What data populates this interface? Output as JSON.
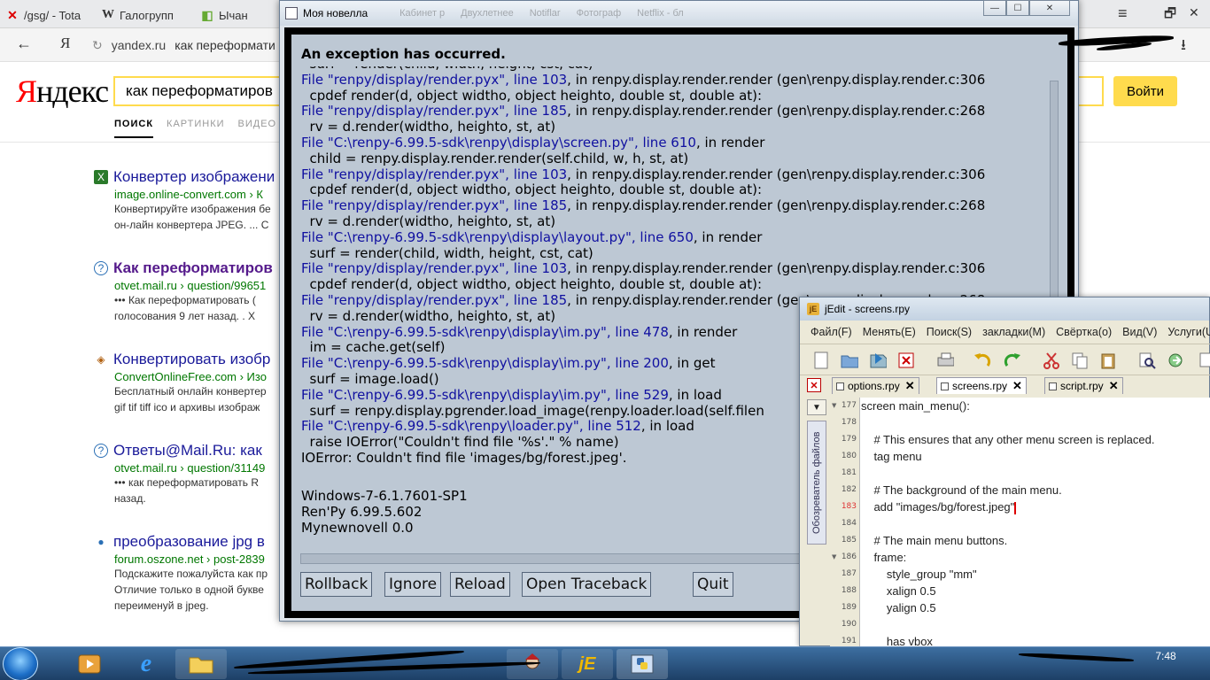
{
  "browser": {
    "tabs": [
      {
        "icon": "✕",
        "label": "/gsg/ - Tota"
      },
      {
        "icon": "W",
        "label": "Галогрупп"
      },
      {
        "icon": "◧",
        "label": "Ычан"
      }
    ],
    "back": "←",
    "yandex_letter": "Я",
    "reload": "↻",
    "address_domain": "yandex.ru",
    "address_query": "как переформати",
    "menu": "≡",
    "restore": "🗗",
    "close": "✕",
    "download": "⭳"
  },
  "yandex": {
    "logo_red": "Я",
    "logo_black": "ндекс",
    "search_value": "как переформатиров",
    "search_button": "Войти",
    "nav": [
      "ПОИСК",
      "КАРТИНКИ",
      "ВИДЕО"
    ],
    "results": [
      {
        "icon": "X",
        "title": "Конвертер изображени",
        "url": "image.online-convert.com › К",
        "snippet": [
          "Конвертируйте изображения бе",
          "он-лайн конвертера JPEG. ... C"
        ]
      },
      {
        "icon": "?",
        "title": "Как переформатиров",
        "url": "otvet.mail.ru › question/99651",
        "snippet": [
          "••• Как переформатировать (",
          "голосования 9 лет назад. . Х"
        ]
      },
      {
        "icon": "◈",
        "title": "Конвертировать изобр",
        "url": "ConvertOnlineFree.com › Изо",
        "snippet": [
          "Бесплатный онлайн конвертер",
          "gif tif tiff ico и архивы изображ"
        ]
      },
      {
        "icon": "?",
        "title": "Ответы@Mail.Ru: как",
        "url": "otvet.mail.ru › question/31149",
        "snippet": [
          "••• как переформатировать R",
          "назад."
        ]
      },
      {
        "icon": "●",
        "title": "преобразование jpg в",
        "url": "forum.oszone.net › post-2839",
        "snippet": [
          "Подскажите пожалуйста как пр",
          "Отличие только в одной букве",
          "переименуй в jpeg."
        ]
      }
    ]
  },
  "renpy": {
    "window_title": "Моя новелла",
    "ghost_tabs": [
      "Кабинет р",
      "Двухлетнее",
      "Notiflar",
      "Фотограф",
      "Netflix - бл"
    ],
    "controls": {
      "minimize": "—",
      "maximize": "☐",
      "close": "✕"
    },
    "exception_title": "An exception has occurred.",
    "traceback": [
      {
        "type": "cut",
        "text": "  surf = render(child, width, height, cst, cat)"
      },
      {
        "type": "file",
        "file": "File \"renpy/display/render.pyx\", line 103",
        "rest": ", in renpy.display.render.render (gen\\renpy.display.render.c:306"
      },
      {
        "type": "src",
        "text": "  cpdef render(d, object widtho, object heighto, double st, double at):"
      },
      {
        "type": "file",
        "file": "File \"renpy/display/render.pyx\", line 185",
        "rest": ", in renpy.display.render.render (gen\\renpy.display.render.c:268"
      },
      {
        "type": "src",
        "text": "  rv = d.render(widtho, heighto, st, at)"
      },
      {
        "type": "file",
        "file": "File \"C:\\renpy-6.99.5-sdk\\renpy\\display\\screen.py\", line 610",
        "rest": ", in render"
      },
      {
        "type": "src",
        "text": "  child = renpy.display.render.render(self.child, w, h, st, at)"
      },
      {
        "type": "file",
        "file": "File \"renpy/display/render.pyx\", line 103",
        "rest": ", in renpy.display.render.render (gen\\renpy.display.render.c:306"
      },
      {
        "type": "src",
        "text": "  cpdef render(d, object widtho, object heighto, double st, double at):"
      },
      {
        "type": "file",
        "file": "File \"renpy/display/render.pyx\", line 185",
        "rest": ", in renpy.display.render.render (gen\\renpy.display.render.c:268"
      },
      {
        "type": "src",
        "text": "  rv = d.render(widtho, heighto, st, at)"
      },
      {
        "type": "file",
        "file": "File \"C:\\renpy-6.99.5-sdk\\renpy\\display\\layout.py\", line 650",
        "rest": ", in render"
      },
      {
        "type": "src",
        "text": "  surf = render(child, width, height, cst, cat)"
      },
      {
        "type": "file",
        "file": "File \"renpy/display/render.pyx\", line 103",
        "rest": ", in renpy.display.render.render (gen\\renpy.display.render.c:306"
      },
      {
        "type": "src",
        "text": "  cpdef render(d, object widtho, object heighto, double st, double at):"
      },
      {
        "type": "file",
        "file": "File \"renpy/display/render.pyx\", line 185",
        "rest": ", in renpy.display.render.render (gen\\renpy.display.render.c:268"
      },
      {
        "type": "src",
        "text": "  rv = d.render(widtho, heighto, st, at)"
      },
      {
        "type": "file",
        "file": "File \"C:\\renpy-6.99.5-sdk\\renpy\\display\\im.py\", line 478",
        "rest": ", in render"
      },
      {
        "type": "src",
        "text": "  im = cache.get(self)"
      },
      {
        "type": "file",
        "file": "File \"C:\\renpy-6.99.5-sdk\\renpy\\display\\im.py\", line 200",
        "rest": ", in get"
      },
      {
        "type": "src",
        "text": "  surf = image.load()"
      },
      {
        "type": "file",
        "file": "File \"C:\\renpy-6.99.5-sdk\\renpy\\display\\im.py\", line 529",
        "rest": ", in load"
      },
      {
        "type": "src",
        "text": "  surf = renpy.display.pgrender.load_image(renpy.loader.load(self.filen"
      },
      {
        "type": "file",
        "file": "File \"C:\\renpy-6.99.5-sdk\\renpy\\loader.py\", line 512",
        "rest": ", in load"
      },
      {
        "type": "src",
        "text": "  raise IOError(\"Couldn't find file '%s'.\" % name)"
      },
      {
        "type": "plain",
        "text": "IOError: Couldn't find file 'images/bg/forest.jpeg'."
      }
    ],
    "info": [
      "Windows-7-6.1.7601-SP1",
      "Ren'Py 6.99.5.602",
      "Mynewnovell 0.0"
    ],
    "buttons": {
      "rollback": "Rollback",
      "ignore": "Ignore",
      "reload": "Reload",
      "open_traceback": "Open Traceback",
      "quit": "Quit"
    }
  },
  "jedit": {
    "title": "jEdit - screens.rpy",
    "icon": "jE",
    "menu": [
      "Файл(F)",
      "Менять(E)",
      "Поиск(S)",
      "закладки(M)",
      "Свёртка(o)",
      "Вид(V)",
      "Услуги(U)"
    ],
    "tabs": [
      "options.rpy",
      "screens.rpy",
      "script.rpy"
    ],
    "side_panel": "Обозреватель файлов",
    "line_numbers": [
      "177",
      "178",
      "179",
      "180",
      "181",
      "182",
      "183",
      "184",
      "185",
      "186",
      "187",
      "188",
      "189",
      "190",
      "191"
    ],
    "code": [
      "screen main_menu():",
      "",
      "    # This ensures that any other menu screen is replaced.",
      "    tag menu",
      "",
      "    # The background of the main menu.",
      "    add \"images/bg/forest.jpeg\"",
      "",
      "    # The main menu buttons.",
      "    frame:",
      "        style_group \"mm\"",
      "        xalign 0.5",
      "        yalign 0.5",
      "",
      "        has vbox"
    ]
  },
  "taskbar": {
    "clock": "7:48"
  }
}
